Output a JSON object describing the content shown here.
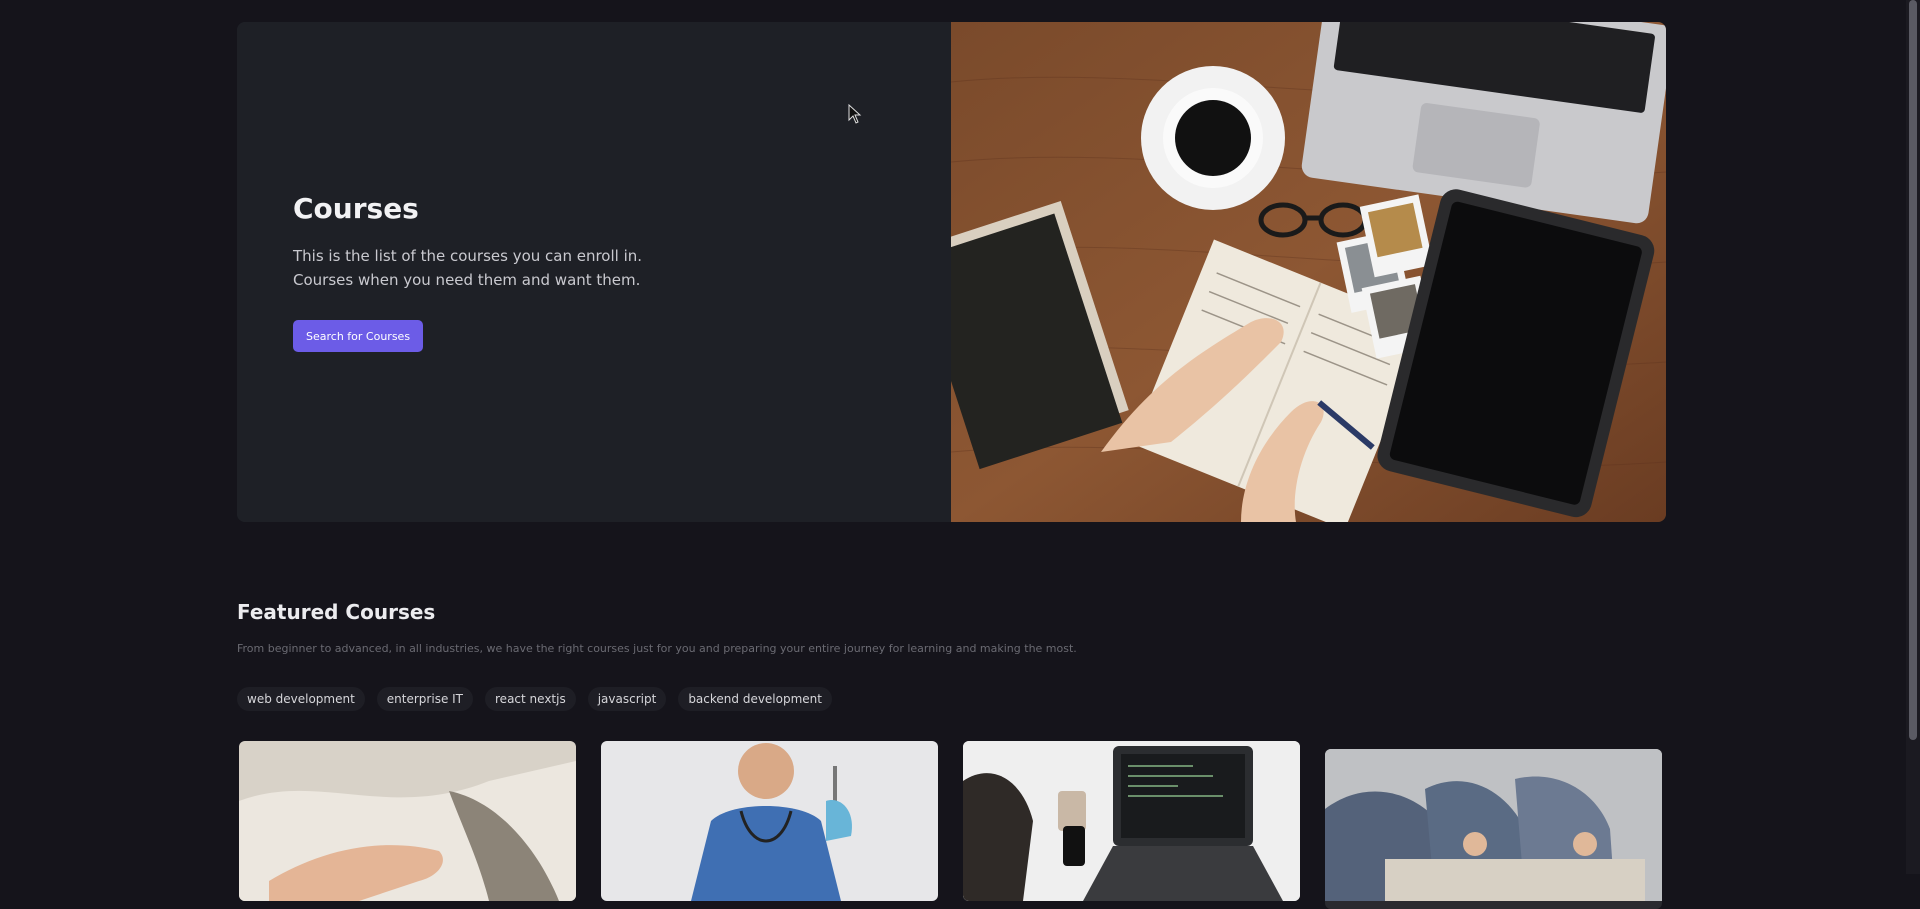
{
  "hero": {
    "title": "Courses",
    "description_lines": [
      "This is the list of the courses you can enroll in.",
      "Courses when you need them and want them."
    ],
    "cta_label": "Search for Courses",
    "image_alt": "Desk with laptop, coffee, notebook and tablet"
  },
  "featured": {
    "title": "Featured Courses",
    "description": "From beginner to advanced, in all industries, we have the right courses just for you and preparing your entire journey for learning and making the most.",
    "tags": [
      "web development",
      "enterprise IT",
      "react nextjs",
      "javascript",
      "backend development"
    ],
    "cards": [
      {
        "image_alt": "hands on a cozy blanket"
      },
      {
        "image_alt": "medical professional holding a syringe"
      },
      {
        "image_alt": "laptop with code and coffee"
      },
      {
        "image_alt": "team meeting around a table"
      }
    ]
  },
  "colors": {
    "page_bg": "#15141b",
    "hero_panel": "#1e2026",
    "accent": "#6c5ce7"
  }
}
